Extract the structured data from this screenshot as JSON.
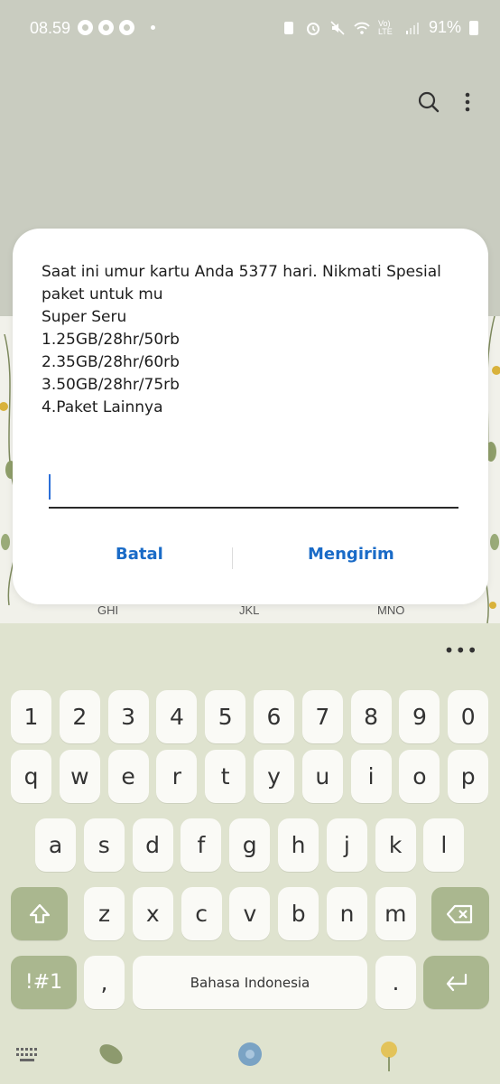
{
  "status_bar": {
    "time": "08.59",
    "signal_label": "Vo) LTE",
    "battery_percent": "91%"
  },
  "keypad_hints": [
    "GHI",
    "JKL",
    "MNO"
  ],
  "dialog": {
    "message": "Saat ini umur kartu Anda 5377 hari. Nikmati Spesial paket untuk mu\nSuper Seru\n1.25GB/28hr/50rb\n2.35GB/28hr/60rb\n3.50GB/28hr/75rb\n4.Paket Lainnya",
    "input_value": "",
    "cancel_label": "Batal",
    "send_label": "Mengirim"
  },
  "keyboard": {
    "row_numbers": [
      "1",
      "2",
      "3",
      "4",
      "5",
      "6",
      "7",
      "8",
      "9",
      "0"
    ],
    "row_top": [
      "q",
      "w",
      "e",
      "r",
      "t",
      "y",
      "u",
      "i",
      "o",
      "p"
    ],
    "row_mid": [
      "a",
      "s",
      "d",
      "f",
      "g",
      "h",
      "j",
      "k",
      "l"
    ],
    "row_bottom": [
      "z",
      "x",
      "c",
      "v",
      "b",
      "n",
      "m"
    ],
    "symbols_label": "!#1",
    "comma_label": ",",
    "space_label": "Bahasa Indonesia",
    "period_label": ".",
    "more_label": "•••"
  },
  "colors": {
    "accent": "#1a6bc7",
    "func_key": "#aab78f",
    "keyboard_bg": "#dfe3cf"
  }
}
